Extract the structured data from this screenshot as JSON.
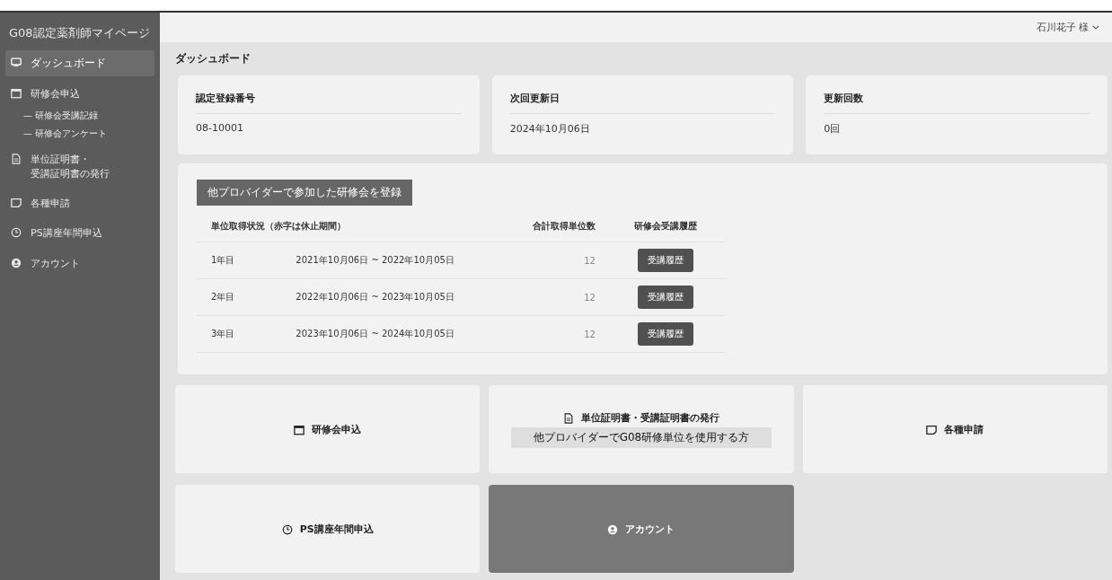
{
  "sidebar": {
    "title": "G08認定薬剤師マイページ",
    "items": [
      {
        "label": [
          "ダッシュボード"
        ],
        "selected": true
      },
      {
        "label": [
          "研修会申込"
        ],
        "selected": false,
        "children": [
          {
            "label": "— 研修会受講記録"
          },
          {
            "label": "— 研修会アンケート"
          }
        ]
      },
      {
        "label": [
          "単位証明書・",
          "受講証明書の発行"
        ],
        "selected": false
      },
      {
        "label": [
          "各種申請"
        ],
        "selected": false
      },
      {
        "label": [
          "PS講座年間申込"
        ],
        "selected": false
      },
      {
        "label": [
          "アカウント"
        ],
        "selected": false
      }
    ]
  },
  "top_bar": {
    "user": "石川花子 様"
  },
  "page_title": "ダッシュボード",
  "info_cards": [
    {
      "label": "認定登録番号",
      "value": "08-10001"
    },
    {
      "label": "次回更新日",
      "value": "2024年10月06日"
    },
    {
      "label": "更新回数",
      "value": "0回"
    }
  ],
  "credits": {
    "register_button": "他プロバイダーで参加した研修会を登録",
    "columns": [
      "単位取得状況（赤字は休止期間）",
      "合計取得単位数",
      "研修会受講履歴"
    ],
    "rows": [
      {
        "year": "1年目",
        "period": "2021年10月06日 ~ 2022年10月05日",
        "credits": "12",
        "button": "受講履歴"
      },
      {
        "year": "2年目",
        "period": "2022年10月06日 ~ 2023年10月05日",
        "credits": "12",
        "button": "受講履歴"
      },
      {
        "year": "3年目",
        "period": "2023年10月06日 ~ 2024年10月05日",
        "credits": "12",
        "button": "受講履歴"
      }
    ]
  },
  "tiles": [
    {
      "label": "研修会申込",
      "highlighted": false
    },
    {
      "label": "単位証明書・受講証明書の発行",
      "highlighted": false,
      "note": "他プロバイダーでG08研修単位を使用する方"
    },
    {
      "label": "各種申請",
      "highlighted": false
    },
    {
      "label": "PS講座年間申込",
      "highlighted": false
    },
    {
      "label": "アカウント",
      "highlighted": true
    }
  ]
}
